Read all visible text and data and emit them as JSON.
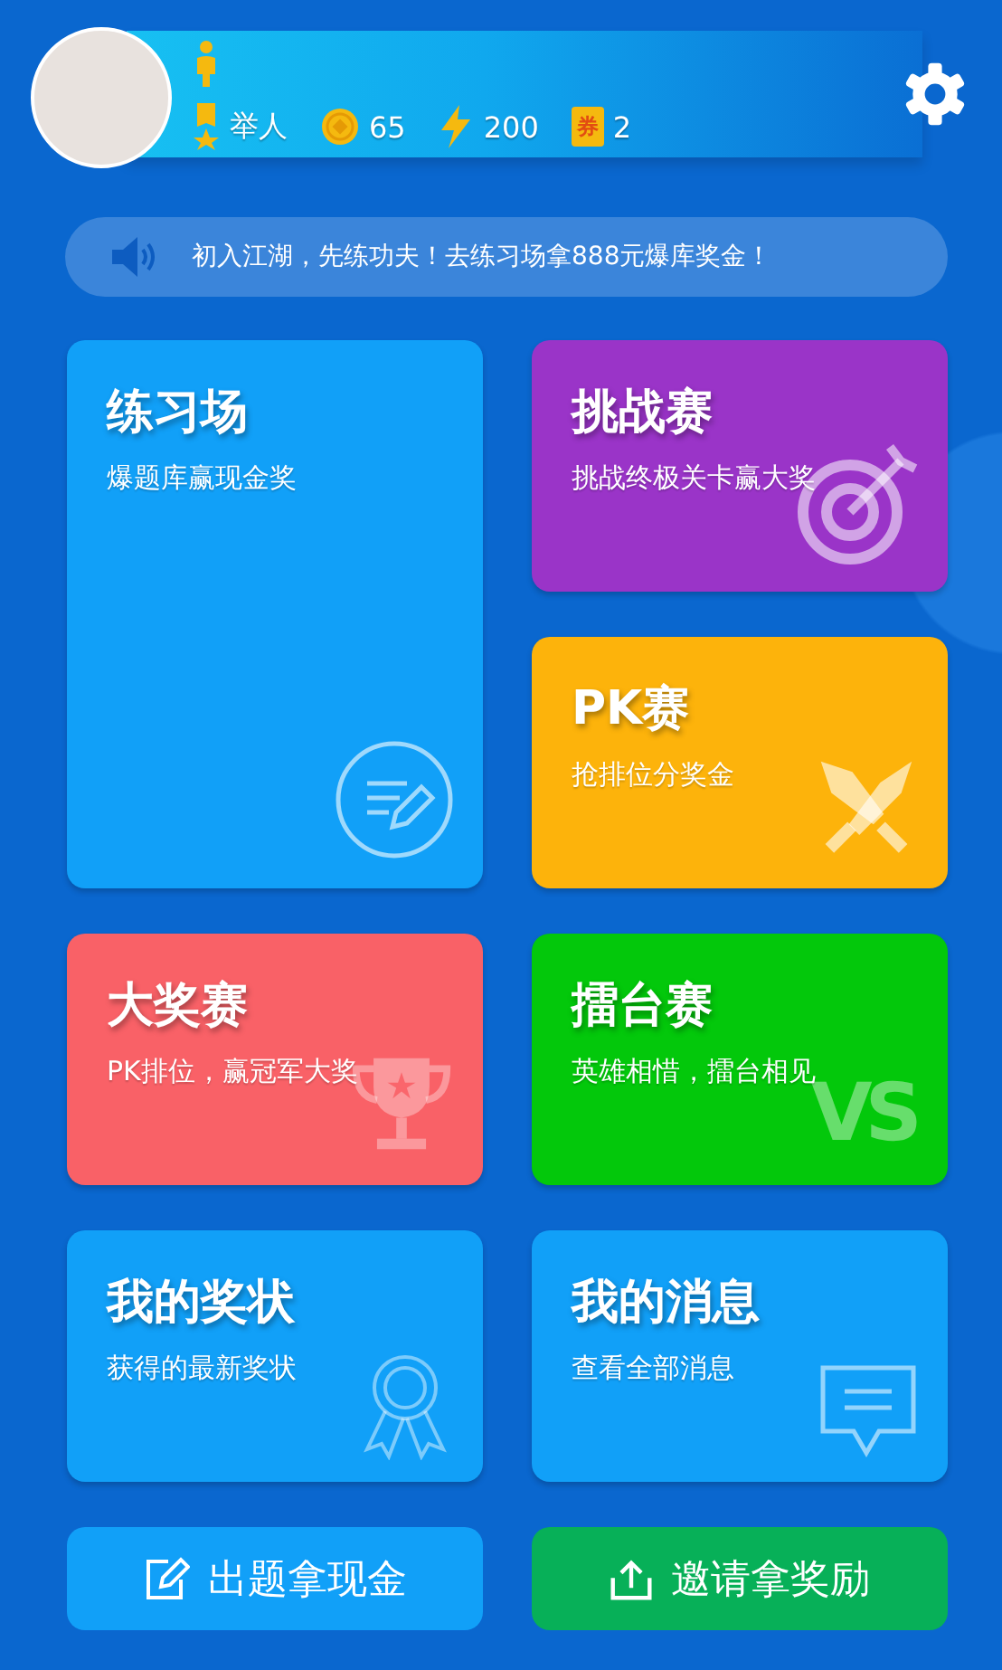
{
  "profile": {
    "rank": "举人",
    "coins": "65",
    "energy": "200",
    "ticket_label": "券",
    "tickets": "2"
  },
  "notice": {
    "text": "初入江湖，先练功夫！去练习场拿888元爆库奖金！"
  },
  "cards": [
    {
      "kind": "practice",
      "title": "练习场",
      "subtitle": "爆题库赢现金奖",
      "color": "#11a0f8",
      "tall": true
    },
    {
      "kind": "challenge",
      "title": "挑战赛",
      "subtitle": "挑战终极关卡赢大奖",
      "color": "#9a34c8",
      "tall": false
    },
    {
      "kind": "pk",
      "title": "PK赛",
      "subtitle": "抢排位分奖金",
      "color": "#fdb30b",
      "tall": false
    },
    {
      "kind": "grand",
      "title": "大奖赛",
      "subtitle": "PK排位，赢冠军大奖",
      "color": "#f96167",
      "tall": false
    },
    {
      "kind": "arena",
      "title": "擂台赛",
      "subtitle": "英雄相惜，擂台相见",
      "color": "#03c80b",
      "tall": false,
      "mark": "VS"
    },
    {
      "kind": "awards",
      "title": "我的奖状",
      "subtitle": "获得的最新奖状",
      "color": "#11a0f8",
      "tall": false
    },
    {
      "kind": "messages",
      "title": "我的消息",
      "subtitle": "查看全部消息",
      "color": "#11a0f8",
      "tall": false
    }
  ],
  "buttons": [
    {
      "kind": "edit",
      "label": "出题拿现金",
      "color": "#11a0f8"
    },
    {
      "kind": "share",
      "label": "邀请拿奖励",
      "color": "#07b058"
    }
  ]
}
